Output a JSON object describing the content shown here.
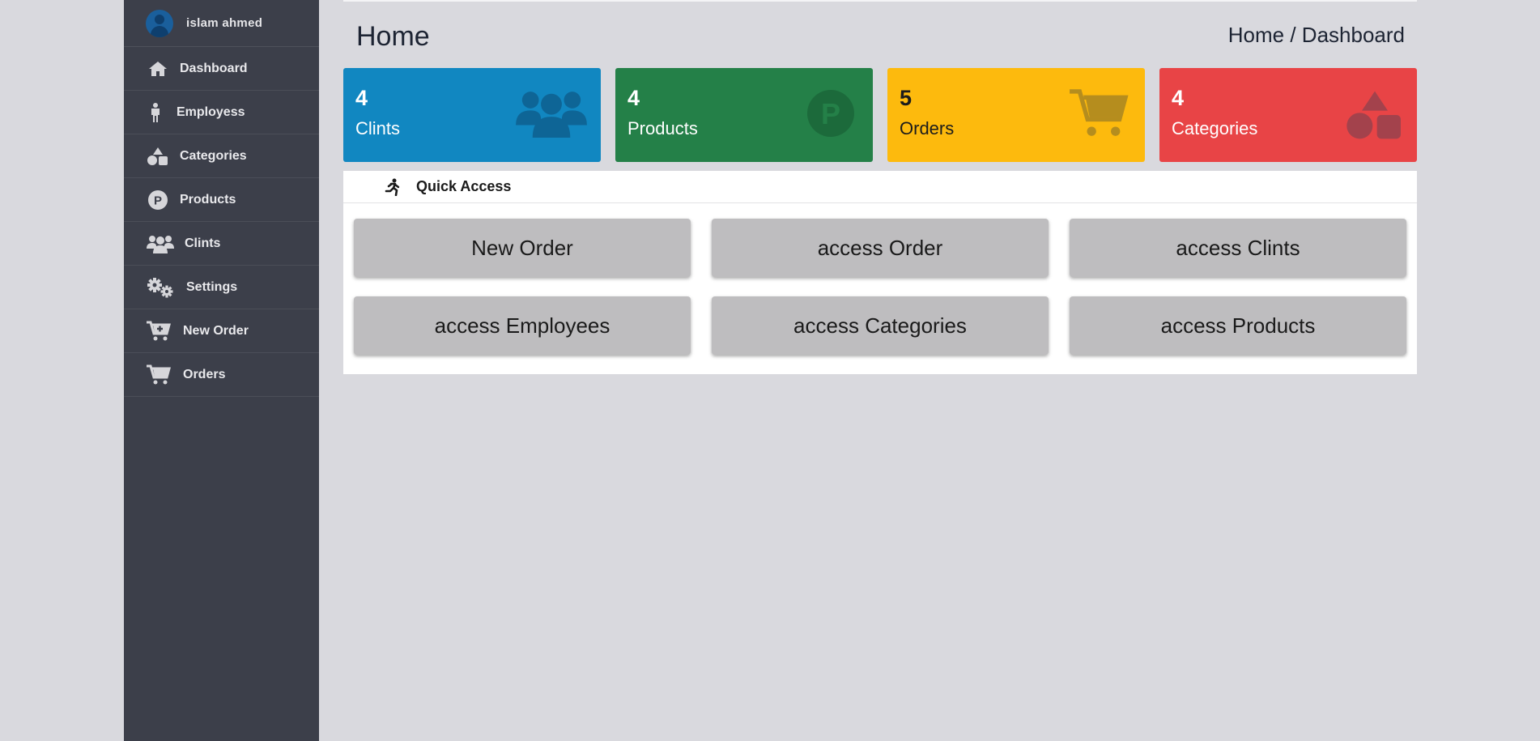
{
  "user": {
    "name": "islam ahmed"
  },
  "sidebar": {
    "items": [
      {
        "label": "Dashboard",
        "icon": "home-icon"
      },
      {
        "label": "Employess",
        "icon": "person-icon"
      },
      {
        "label": "Categories",
        "icon": "shapes-icon"
      },
      {
        "label": "Products",
        "icon": "product-p-icon"
      },
      {
        "label": "Clints",
        "icon": "users-icon"
      },
      {
        "label": "Settings",
        "icon": "gears-icon"
      },
      {
        "label": "New Order",
        "icon": "cart-plus-icon"
      },
      {
        "label": "Orders",
        "icon": "cart-icon"
      }
    ]
  },
  "header": {
    "title": "Home",
    "breadcrumb": "Home / Dashboard"
  },
  "cards": [
    {
      "count": "4",
      "label": "Clints",
      "color": "#1187c1",
      "icon": "users-icon"
    },
    {
      "count": "4",
      "label": "Products",
      "color": "#248048",
      "icon": "product-p-icon"
    },
    {
      "count": "5",
      "label": "Orders",
      "color": "#fdba0d",
      "icon": "cart-icon"
    },
    {
      "count": "4",
      "label": "Categories",
      "color": "#e84446",
      "icon": "shapes-icon"
    }
  ],
  "quick_access": {
    "title": "Quick Access",
    "icon": "running-person-icon",
    "buttons": [
      "New Order",
      "access Order",
      "access Clints",
      "access Employees",
      "access Categories",
      "access Products"
    ]
  }
}
